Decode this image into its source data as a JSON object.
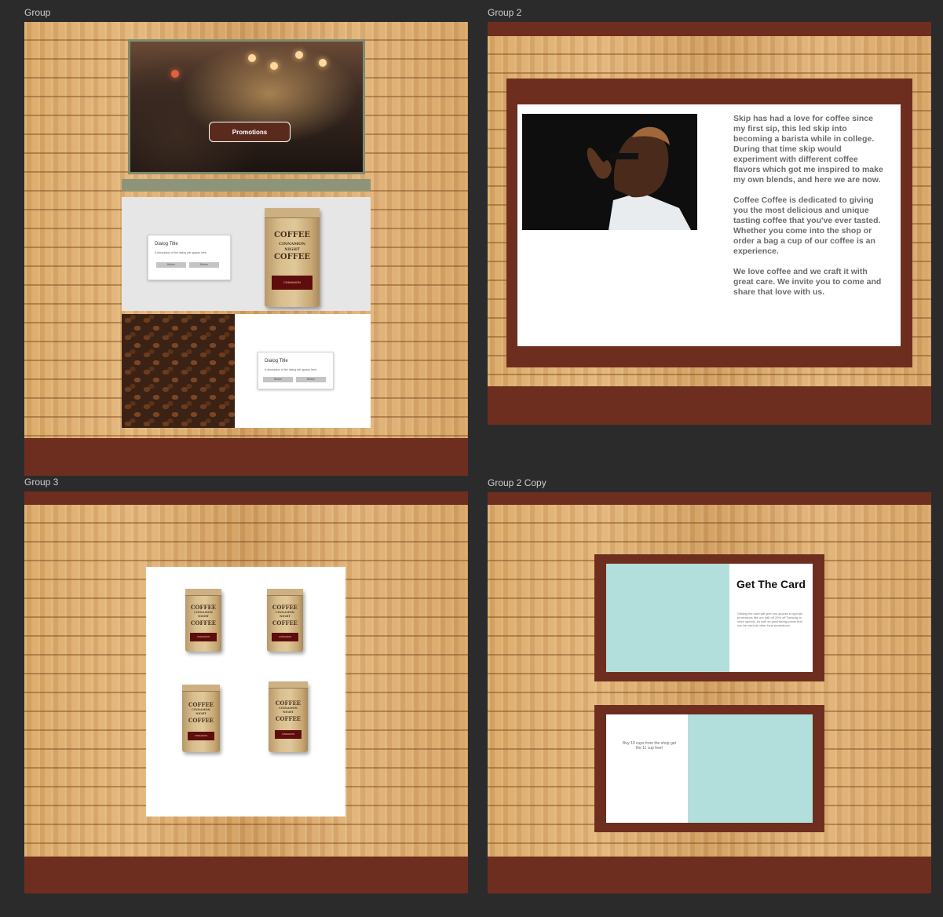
{
  "artboards": {
    "a1": {
      "label": "Group"
    },
    "a2": {
      "label": "Group 2"
    },
    "a3": {
      "label": "Group 3"
    },
    "a4": {
      "label": "Group 2 Copy"
    }
  },
  "group1": {
    "promo_button": "Promotions",
    "dialogs": [
      {
        "title": "Dialog Title",
        "description": "A description of the dialog will appear here.",
        "button1": "Button",
        "button2": "Button"
      },
      {
        "title": "Dialog Title",
        "description": "A description of the dialog will appear here.",
        "button1": "Button",
        "button2": "Button"
      }
    ],
    "bag": {
      "line1": "COFFEE",
      "line2": "CINNAMON",
      "line3": "NIGHT",
      "line4": "COFFEE",
      "tag": "CINNAMON"
    }
  },
  "group2": {
    "paragraphs": [
      "Skip has had a love for coffee since my first sip, this led skip into becoming a barista while in college. During that time skip would experiment with different coffee flavors which got me inspired to make my own blends, and here we are now.",
      "Coffee Coffee is dedicated to giving you the most delicious and unique tasting coffee that you've ever tasted. Whether you come into the shop or order a bag a cup of our coffee is an experience.",
      "We love coffee and we craft it with great care. We invite you to come and share that love with us."
    ]
  },
  "group3": {
    "bags": [
      {
        "line1": "COFFEE",
        "line2": "CINNAMON",
        "line3": "NIGHT",
        "line4": "COFFEE",
        "tag": "CINNAMON"
      },
      {
        "line1": "COFFEE",
        "line2": "CINNAMON",
        "line3": "NIGHT",
        "line4": "COFFEE",
        "tag": "CINNAMON"
      },
      {
        "line1": "COFFEE",
        "line2": "CINNAMON",
        "line3": "NIGHT",
        "line4": "COFFEE",
        "tag": "CINNAMON"
      },
      {
        "line1": "COFFEE",
        "line2": "CINNAMON",
        "line3": "NIGHT",
        "line4": "COFFEE",
        "tag": "CINNAMON"
      }
    ]
  },
  "group2copy": {
    "card_title": "Get The Card",
    "card_desc": "Getting the card will give you access to special promotions like our half off 20% off Tuesday in store special. As well as purchasing points that can be used at other local promotions.",
    "offer": "Buy 10 cups from the shop get the 11 cup free!"
  },
  "colors": {
    "brown": "#6e2e1f",
    "teal": "#b2dfdc",
    "background": "#2b2b2b",
    "olive": "#8e9478"
  }
}
